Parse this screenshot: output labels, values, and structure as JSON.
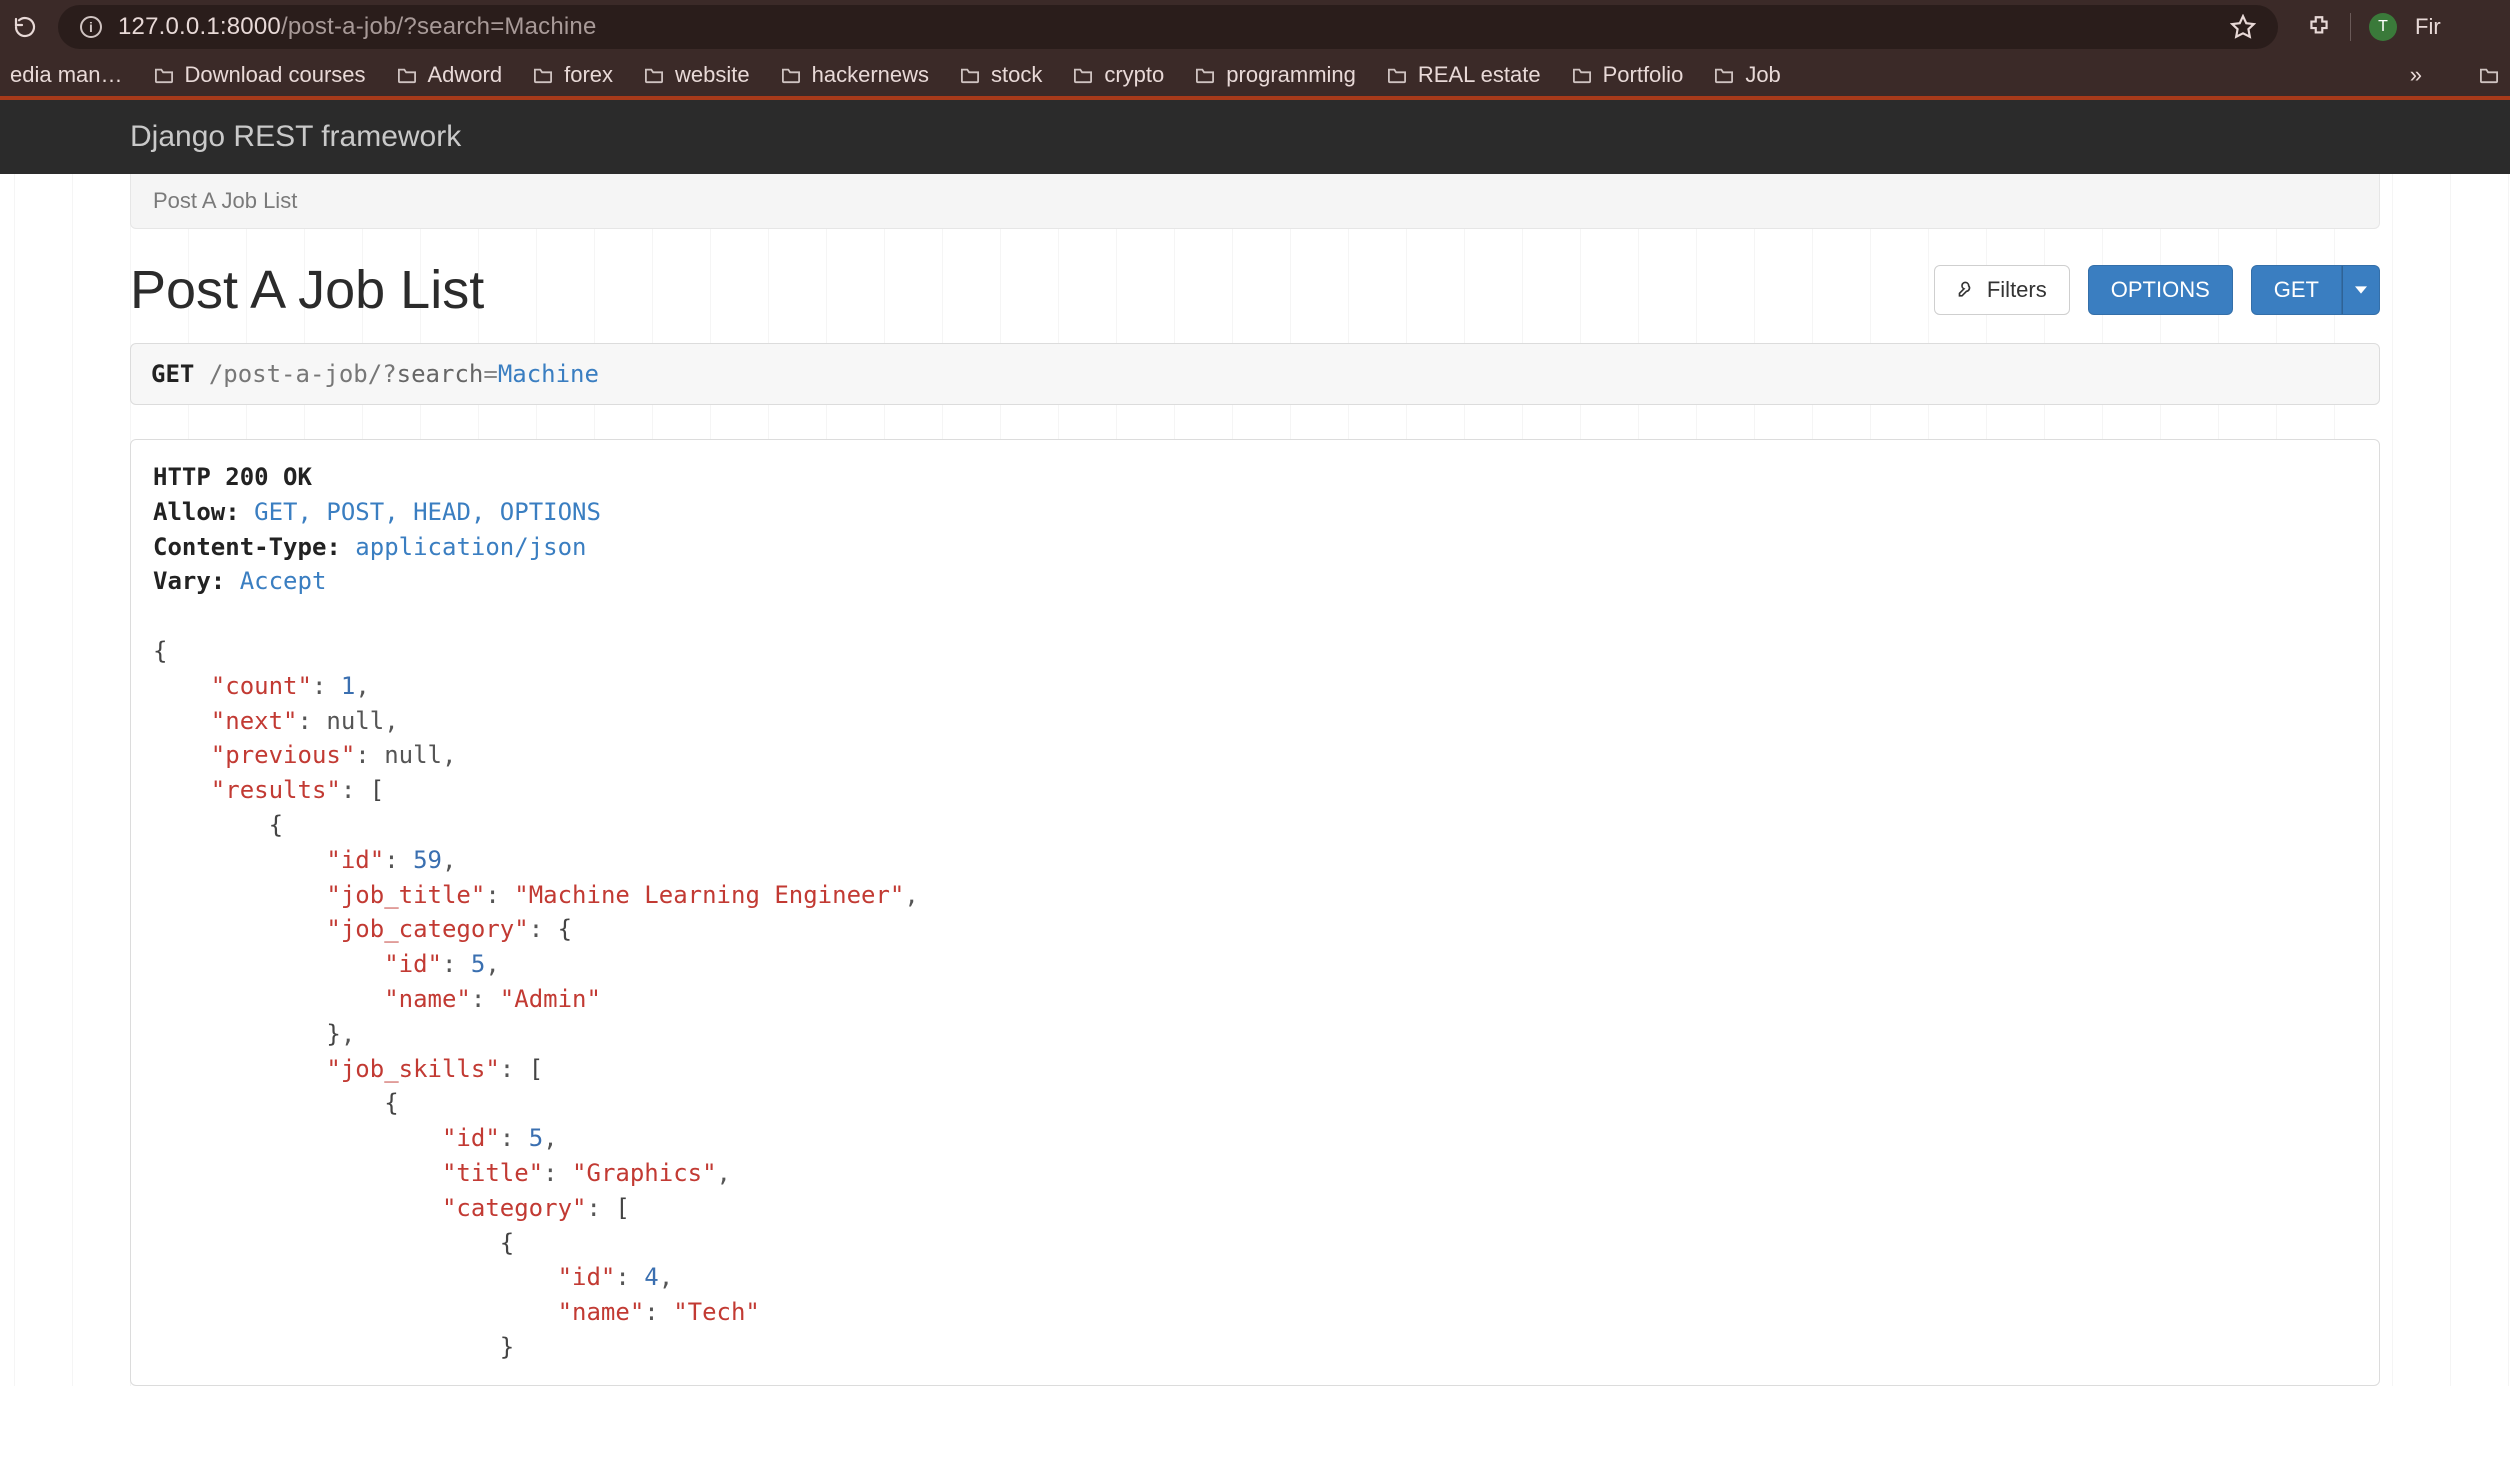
{
  "browser": {
    "url_host": "127.0.0.1:8000",
    "url_path": "/post-a-job/?search=Machine",
    "profile_initial": "T",
    "right_label": "Fir"
  },
  "bookmarks": [
    "edia man…",
    "Download courses",
    "Adword",
    "forex",
    "website",
    "hackernews",
    "stock",
    "crypto",
    "programming",
    "REAL estate",
    "Portfolio",
    "Job"
  ],
  "drf": {
    "brand": "Django REST framework",
    "breadcrumb": "Post A Job List",
    "title": "Post A Job List",
    "buttons": {
      "filters": "Filters",
      "options": "OPTIONS",
      "get": "GET"
    },
    "request": {
      "method": "GET",
      "path": "/post-a-job/",
      "query_key": "search",
      "query_value": "Machine"
    },
    "response": {
      "status_line": "HTTP 200 OK",
      "headers": {
        "Allow": "GET, POST, HEAD, OPTIONS",
        "Content-Type": "application/json",
        "Vary": "Accept"
      },
      "body": {
        "count": 1,
        "next": null,
        "previous": null,
        "results": [
          {
            "id": 59,
            "job_title": "Machine Learning Engineer",
            "job_category": {
              "id": 5,
              "name": "Admin"
            },
            "job_skills": [
              {
                "id": 5,
                "title": "Graphics",
                "category": [
                  {
                    "id": 4,
                    "name": "Tech"
                  }
                ]
              }
            ]
          }
        ]
      }
    }
  }
}
